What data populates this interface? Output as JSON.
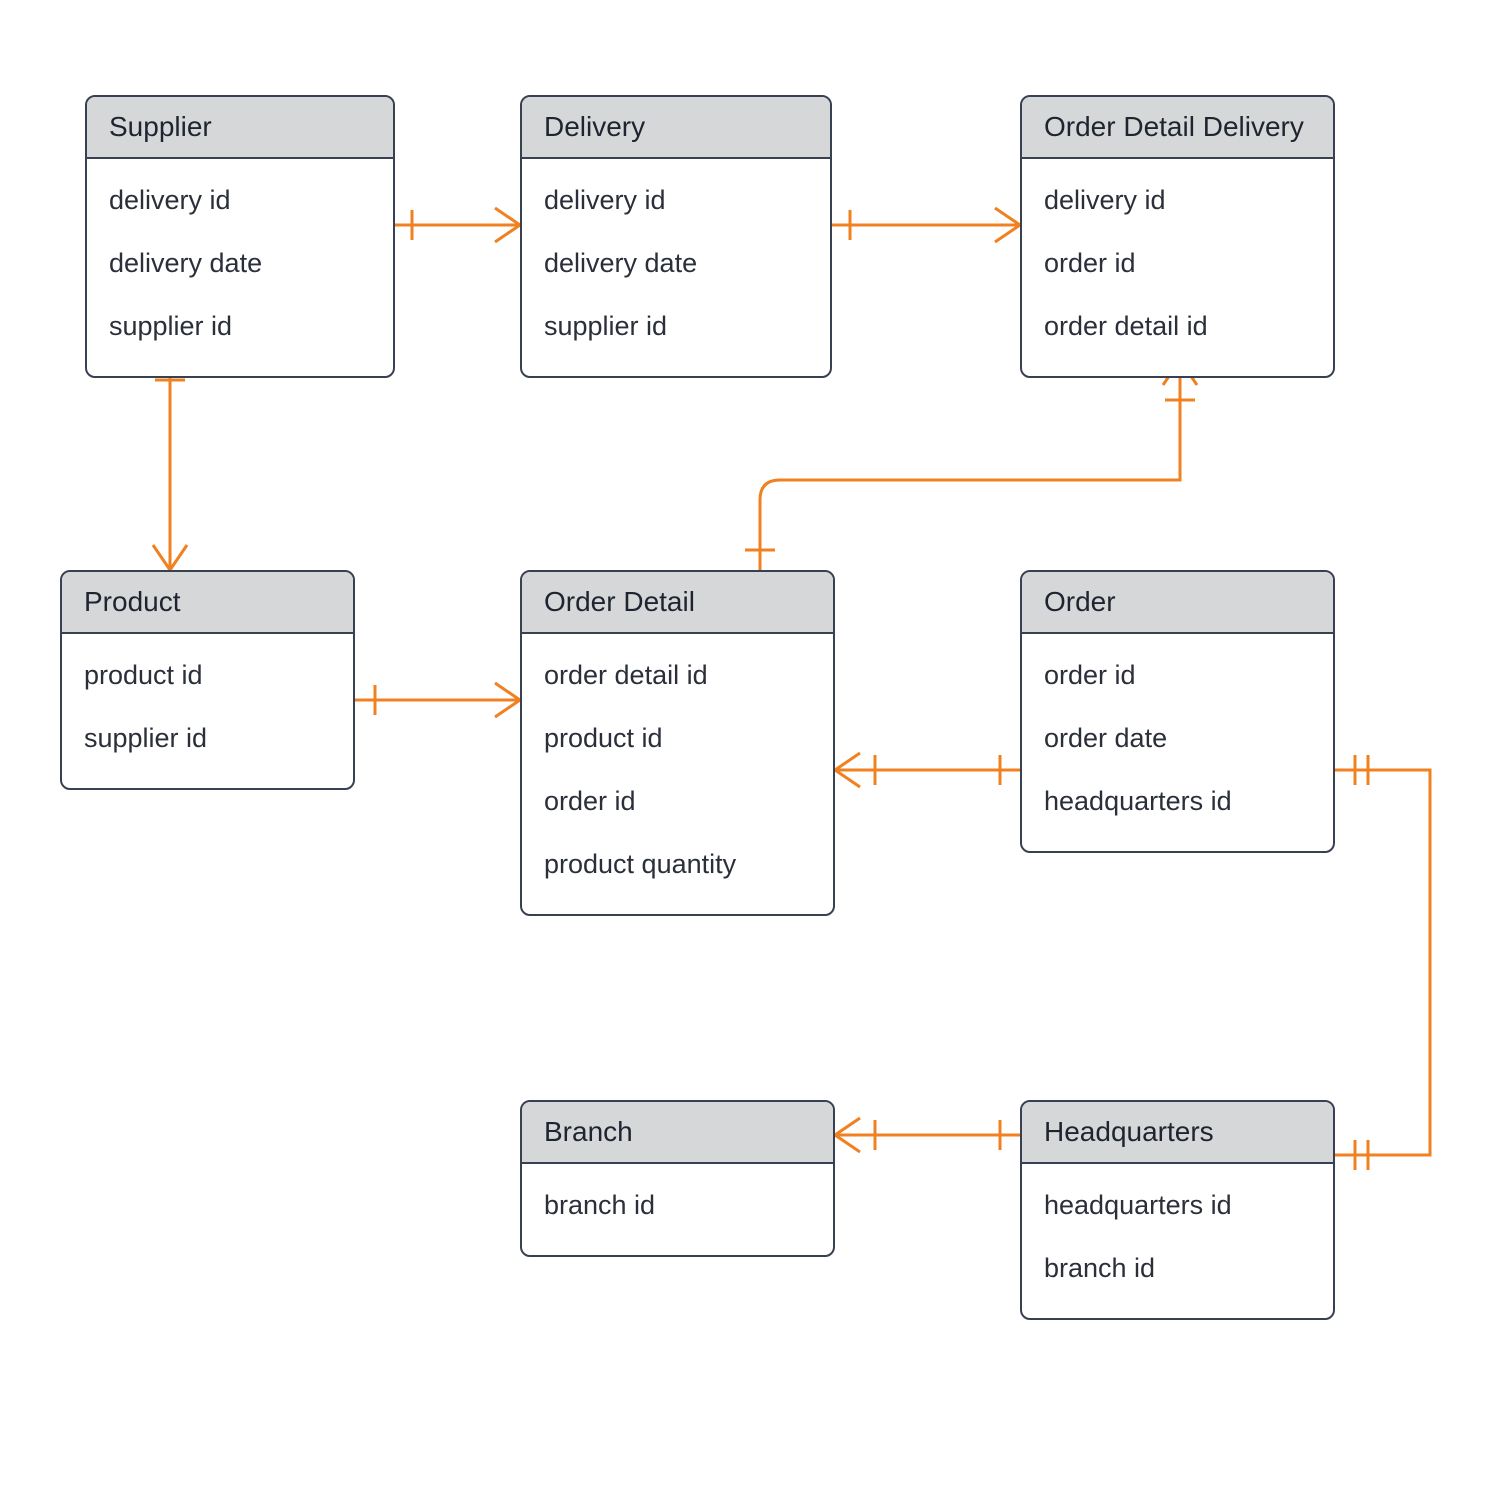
{
  "entities": {
    "supplier": {
      "title": "Supplier",
      "attrs": [
        "delivery id",
        "delivery date",
        "supplier id"
      ]
    },
    "delivery": {
      "title": "Delivery",
      "attrs": [
        "delivery id",
        "delivery date",
        "supplier id"
      ]
    },
    "orderDetailDelivery": {
      "title": "Order Detail Delivery",
      "attrs": [
        "delivery id",
        "order id",
        "order detail id"
      ]
    },
    "product": {
      "title": "Product",
      "attrs": [
        "product id",
        "supplier id"
      ]
    },
    "orderDetail": {
      "title": "Order Detail",
      "attrs": [
        "order detail id",
        "product id",
        "order id",
        "product quantity"
      ]
    },
    "order": {
      "title": "Order",
      "attrs": [
        "order id",
        "order date",
        "headquarters id"
      ]
    },
    "branch": {
      "title": "Branch",
      "attrs": [
        "branch id"
      ]
    },
    "headquarters": {
      "title": "Headquarters",
      "attrs": [
        "headquarters id",
        "branch id"
      ]
    }
  },
  "colors": {
    "connector": "#f08020",
    "border": "#374151",
    "header": "#d6d7d8"
  }
}
